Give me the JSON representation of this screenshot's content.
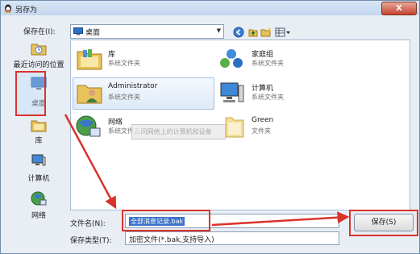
{
  "window": {
    "title": "另存为",
    "close_label": "X"
  },
  "save_in": {
    "label": "保存在(I):",
    "value": "桌面"
  },
  "sidebar": {
    "items": [
      {
        "label": "最近访问的位置",
        "icon": "recent-places-icon"
      },
      {
        "label": "桌面",
        "icon": "desktop-icon"
      },
      {
        "label": "库",
        "icon": "libraries-icon"
      },
      {
        "label": "计算机",
        "icon": "computer-icon"
      },
      {
        "label": "网络",
        "icon": "network-icon"
      }
    ]
  },
  "files": [
    {
      "name": "库",
      "type": "系统文件夹",
      "icon": "libraries-icon"
    },
    {
      "name": "家庭组",
      "type": "系统文件夹",
      "icon": "homegroup-icon"
    },
    {
      "name": "Administrator",
      "type": "系统文件夹",
      "icon": "user-folder-icon"
    },
    {
      "name": "计算机",
      "type": "系统文件夹",
      "icon": "computer-icon"
    },
    {
      "name": "网络",
      "type": "系统文件夹",
      "icon": "network-icon"
    },
    {
      "name": "Green",
      "type": "文件夹",
      "icon": "folder-icon"
    }
  ],
  "tooltip": "...问网络上的计算机和设备",
  "filename": {
    "label": "文件名(N):",
    "value": "全部消息记录.bak"
  },
  "filetype": {
    "label": "保存类型(T):",
    "value": "加密文件(*.bak,支持导入)"
  },
  "buttons": {
    "save": "保存(S)"
  },
  "colors": {
    "annotation_red": "#d9332c",
    "selection_blue": "#3b73c9"
  }
}
